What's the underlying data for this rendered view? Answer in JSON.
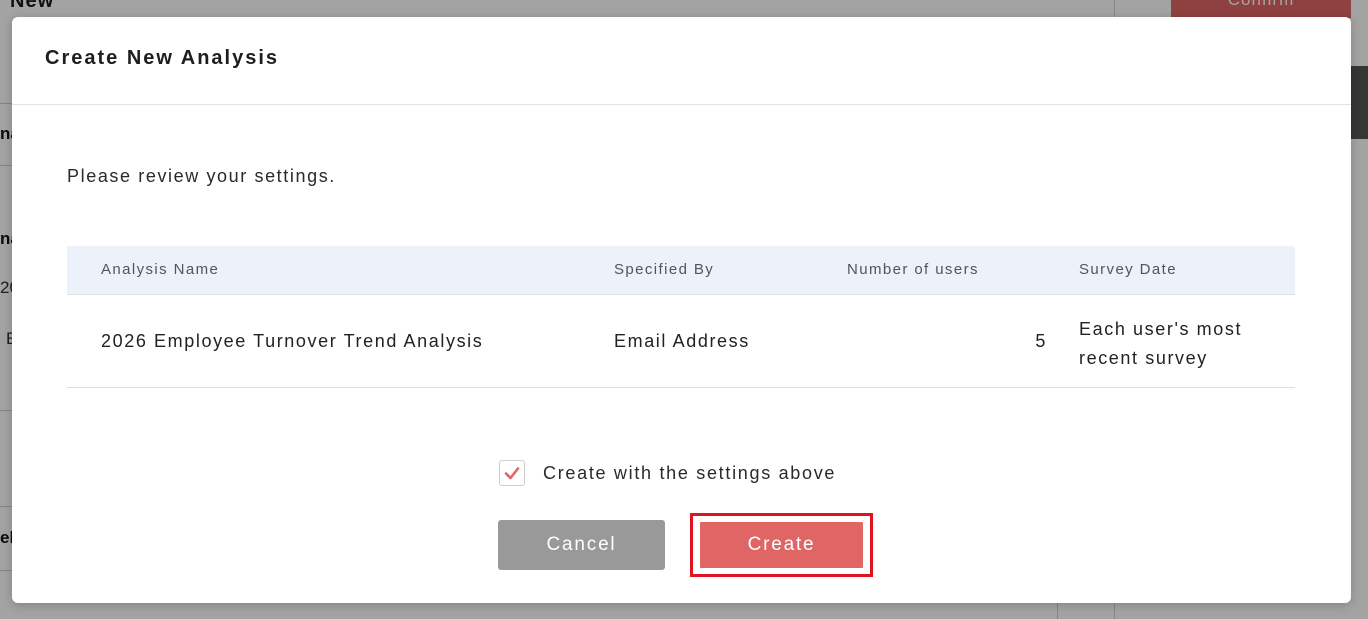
{
  "background": {
    "title": "New",
    "confirm_label": "Confirm",
    "fragments": [
      "na",
      "na",
      "20",
      "E",
      "el"
    ]
  },
  "modal": {
    "title": "Create New Analysis",
    "intro": "Please review your settings.",
    "table": {
      "headers": [
        "Analysis Name",
        "Specified By",
        "Number of users",
        "Survey Date"
      ],
      "row": {
        "analysis_name": "2026 Employee Turnover Trend Analysis",
        "specified_by": "Email Address",
        "number_of_users": "5",
        "survey_date": "Each user's most recent survey"
      }
    },
    "confirm_checkbox": {
      "label": "Create with the settings above",
      "checked": true
    },
    "buttons": {
      "cancel": "Cancel",
      "create": "Create"
    }
  },
  "colors": {
    "accent": "#e06666",
    "cancel": "#999999",
    "highlight": "#e0141e",
    "table_header_bg": "#ecf1fa"
  },
  "icons": {
    "checkbox_mark": "check-icon"
  }
}
